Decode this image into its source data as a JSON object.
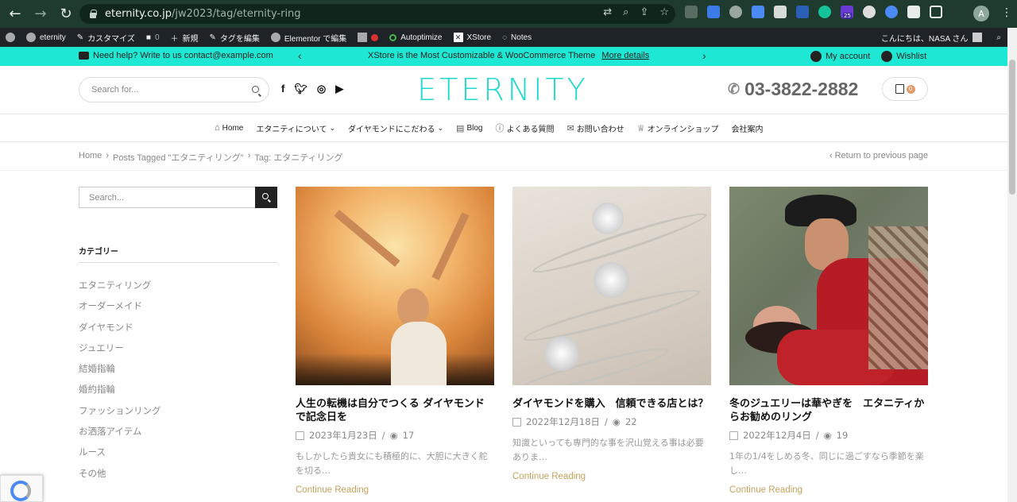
{
  "browser": {
    "url_host": "eternity.co.jp",
    "url_path": "/jw2023/tag/eternity-ring",
    "profile_initial": "A",
    "ext_badge": "25"
  },
  "adminbar": {
    "site": "eternity",
    "customize": "カスタマイズ",
    "comments": "0",
    "new": "新規",
    "edit_tag": "タグを編集",
    "elementor": "Elementor で編集",
    "autoptimize": "Autoptimize",
    "xstore": "XStore",
    "notes": "Notes",
    "greeting": "こんにちは、NASA さん"
  },
  "promo": {
    "help": "Need help? Write to us contact@example.com",
    "message": "XStore is the Most Customizable & WooCommerce Theme",
    "link": "More details",
    "account": "My account",
    "wishlist": "Wishlist"
  },
  "header": {
    "search_placeholder": "Search for...",
    "logo": "ETERNITY",
    "phone": "03-3822-2882",
    "cart_count": "0"
  },
  "nav": {
    "items": [
      {
        "label": "Home",
        "icon": "⌂",
        "caret": ""
      },
      {
        "label": "エタニティについて",
        "icon": "",
        "caret": "⌄"
      },
      {
        "label": "ダイヤモンドにこだわる",
        "icon": "",
        "caret": "⌄"
      },
      {
        "label": "Blog",
        "icon": "▤",
        "caret": ""
      },
      {
        "label": "よくある質問",
        "icon": "ⓘ",
        "caret": ""
      },
      {
        "label": "お問い合わせ",
        "icon": "✉",
        "caret": ""
      },
      {
        "label": "オンラインショップ",
        "icon": "♕",
        "caret": ""
      },
      {
        "label": "会社案内",
        "icon": "",
        "caret": ""
      }
    ]
  },
  "breadcrumb": {
    "home": "Home",
    "posts_tagged": "Posts Tagged \"エタニティリング\"",
    "current": "Tag: エタニティリング",
    "back": "Return to previous page"
  },
  "sidebar": {
    "search_placeholder": "Search...",
    "category_title": "カテゴリー",
    "categories": [
      "エタニティリング",
      "オーダーメイド",
      "ダイヤモンド",
      "ジュエリー",
      "結婚指輪",
      "婚約指輪",
      "ファッションリング",
      "お洒落アイテム",
      "ルース",
      "その他"
    ]
  },
  "posts": [
    {
      "title": "人生の転機は自分でつくる ダイヤモンドで記念日を",
      "date": "2023年1月23日",
      "views": "17",
      "excerpt": "もしかしたら貴女にも積極的に、大胆に大きく舵を切る…",
      "more": "Continue Reading"
    },
    {
      "title": "ダイヤモンドを購入　信頼できる店とは？",
      "date": "2022年12月18日",
      "views": "22",
      "excerpt": "知識といっても専門的な事を沢山覚える事は必要ありま…",
      "more": "Continue Reading"
    },
    {
      "title": "冬のジュエリーは華やぎを　エタニティからお勧めのリング",
      "date": "2022年12月4日",
      "views": "19",
      "excerpt": "1年の1/4をしめる冬、同じに過ごすなら季節を楽し…",
      "more": "Continue Reading"
    }
  ],
  "colors": {
    "accent": "#1ee8d3",
    "logo": "#1ed9cf",
    "link": "#c7a15d",
    "adminbar": "#1d2327",
    "chrome": "#1f3a2e"
  }
}
